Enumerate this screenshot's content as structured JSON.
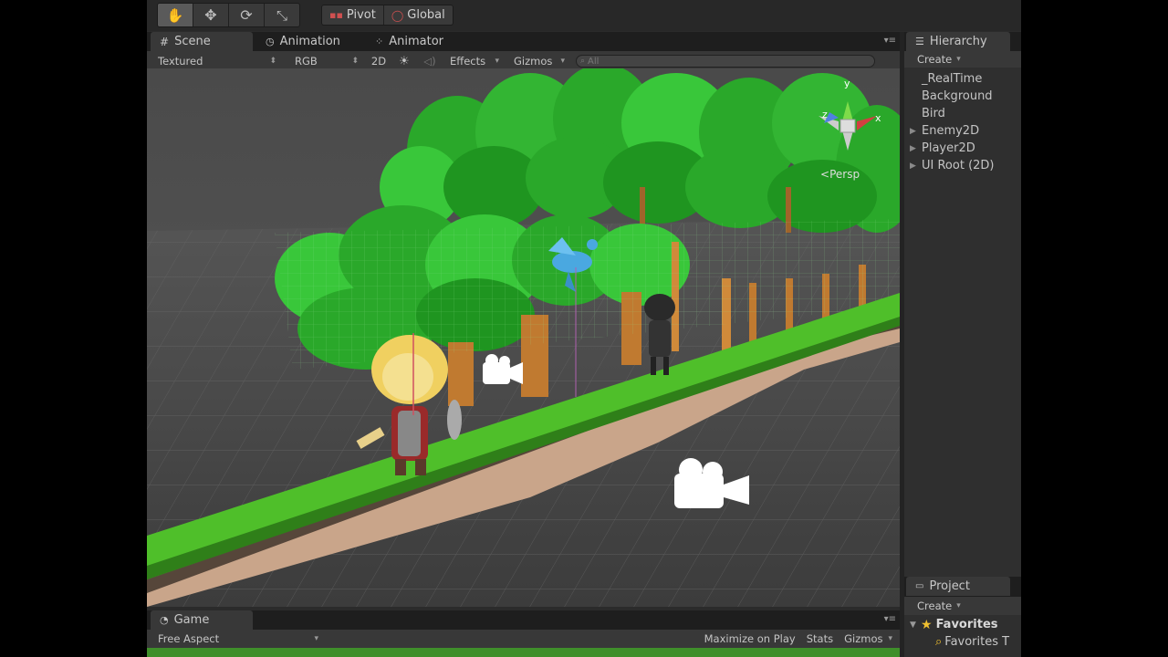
{
  "toolbar": {
    "tools": [
      {
        "name": "hand-tool-button",
        "icon": "hand-icon",
        "glyph": "✋",
        "active": true
      },
      {
        "name": "move-tool-button",
        "icon": "move-arrows-icon",
        "glyph": "✥",
        "active": false
      },
      {
        "name": "rotate-tool-button",
        "icon": "rotate-icon",
        "glyph": "⟳",
        "active": false
      },
      {
        "name": "scale-tool-button",
        "icon": "scale-icon",
        "glyph": "⤡",
        "active": false
      }
    ],
    "pivot_label": "Pivot",
    "global_label": "Global"
  },
  "scene": {
    "tabs": {
      "scene": "Scene",
      "animation": "Animation",
      "animator": "Animator"
    },
    "menu_glyph": "▾≡",
    "shading_mode": "Textured",
    "render_mode": "RGB",
    "mode_2d": "2D",
    "effects_label": "Effects",
    "gizmos_label": "Gizmos",
    "search_placeholder": "All",
    "persp_label": "Persp",
    "axis_labels": {
      "y": "y",
      "z": "z",
      "x": "x"
    }
  },
  "game": {
    "tab_label": "Game",
    "aspect": "Free Aspect",
    "maximize_label": "Maximize on Play",
    "stats_label": "Stats",
    "gizmos_label": "Gizmos"
  },
  "hierarchy": {
    "tab_label": "Hierarchy",
    "create_label": "Create",
    "items": [
      {
        "label": "_RealTime",
        "expandable": false
      },
      {
        "label": "Background",
        "expandable": false
      },
      {
        "label": "Bird",
        "expandable": false
      },
      {
        "label": "Enemy2D",
        "expandable": true
      },
      {
        "label": "Player2D",
        "expandable": true
      },
      {
        "label": "UI Root (2D)",
        "expandable": true
      }
    ]
  },
  "project": {
    "tab_label": "Project",
    "create_label": "Create",
    "favorites_label": "Favorites",
    "favorites_item": "Favorites T"
  },
  "colors": {
    "grass": "#4fbf2a",
    "tree_light": "#39c73a",
    "tree_dark": "#1e8a1f",
    "soil": "#c9a58a",
    "accent_star": "#f0c030"
  }
}
